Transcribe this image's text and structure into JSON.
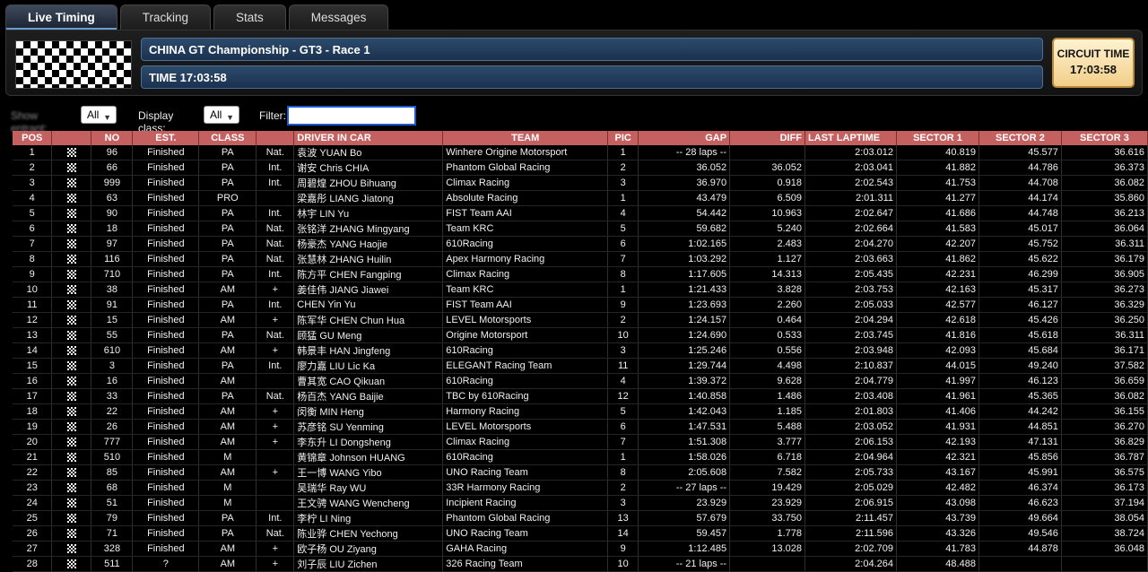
{
  "tabs": [
    "Live Timing",
    "Tracking",
    "Stats",
    "Messages"
  ],
  "header": {
    "title": "CHINA GT Championship - GT3 - Race 1",
    "time": "TIME 17:03:58",
    "circuit_label": "CIRCUIT TIME",
    "circuit_time": "17:03:58"
  },
  "filters": {
    "show_label": "Show entrant:",
    "show_value": "All",
    "class_label": "Display class:",
    "class_value": "All",
    "filter_label": "Filter:"
  },
  "columns": [
    "POS",
    "",
    "NO",
    "EST.",
    "CLASS",
    "",
    "DRIVER IN CAR",
    "TEAM",
    "PIC",
    "GAP",
    "DIFF",
    "LAST LAPTIME",
    "SECTOR 1",
    "SECTOR 2",
    "SECTOR 3"
  ],
  "rows": [
    [
      "1",
      "96",
      "Finished",
      "PA",
      "Nat.",
      "袁波 YUAN Bo",
      "Winhere Origine Motorsport",
      "1",
      "-- 28 laps --",
      "",
      "2:03.012",
      "40.819",
      "45.577",
      "36.616"
    ],
    [
      "2",
      "66",
      "Finished",
      "PA",
      "Int.",
      "谢安 Chris CHIA",
      "Phantom Global Racing",
      "2",
      "36.052",
      "36.052",
      "2:03.041",
      "41.882",
      "44.786",
      "36.373"
    ],
    [
      "3",
      "999",
      "Finished",
      "PA",
      "Int.",
      "周碧煌 ZHOU Bihuang",
      "Climax Racing",
      "3",
      "36.970",
      "0.918",
      "2:02.543",
      "41.753",
      "44.708",
      "36.082"
    ],
    [
      "4",
      "63",
      "Finished",
      "PRO",
      "",
      "梁嘉彤 LIANG Jiatong",
      "Absolute Racing",
      "1",
      "43.479",
      "6.509",
      "2:01.311",
      "41.277",
      "44.174",
      "35.860"
    ],
    [
      "5",
      "90",
      "Finished",
      "PA",
      "Int.",
      "林宇 LIN Yu",
      "FIST Team AAI",
      "4",
      "54.442",
      "10.963",
      "2:02.647",
      "41.686",
      "44.748",
      "36.213"
    ],
    [
      "6",
      "18",
      "Finished",
      "PA",
      "Nat.",
      "张铭洋 ZHANG Mingyang",
      "Team KRC",
      "5",
      "59.682",
      "5.240",
      "2:02.664",
      "41.583",
      "45.017",
      "36.064"
    ],
    [
      "7",
      "97",
      "Finished",
      "PA",
      "Nat.",
      "杨豪杰 YANG Haojie",
      "610Racing",
      "6",
      "1:02.165",
      "2.483",
      "2:04.270",
      "42.207",
      "45.752",
      "36.311"
    ],
    [
      "8",
      "116",
      "Finished",
      "PA",
      "Nat.",
      "张慧林 ZHANG Huilin",
      "Apex Harmony Racing",
      "7",
      "1:03.292",
      "1.127",
      "2:03.663",
      "41.862",
      "45.622",
      "36.179"
    ],
    [
      "9",
      "710",
      "Finished",
      "PA",
      "Int.",
      "陈方平 CHEN Fangping",
      "Climax Racing",
      "8",
      "1:17.605",
      "14.313",
      "2:05.435",
      "42.231",
      "46.299",
      "36.905"
    ],
    [
      "10",
      "38",
      "Finished",
      "AM",
      "+",
      "姜佳伟 JIANG Jiawei",
      "Team KRC",
      "1",
      "1:21.433",
      "3.828",
      "2:03.753",
      "42.163",
      "45.317",
      "36.273"
    ],
    [
      "11",
      "91",
      "Finished",
      "PA",
      "Int.",
      "CHEN Yin Yu",
      "FIST Team AAI",
      "9",
      "1:23.693",
      "2.260",
      "2:05.033",
      "42.577",
      "46.127",
      "36.329"
    ],
    [
      "12",
      "15",
      "Finished",
      "AM",
      "+",
      "陈军华 CHEN Chun Hua",
      "LEVEL Motorsports",
      "2",
      "1:24.157",
      "0.464",
      "2:04.294",
      "42.618",
      "45.426",
      "36.250"
    ],
    [
      "13",
      "55",
      "Finished",
      "PA",
      "Nat.",
      "顾猛 GU Meng",
      "Origine Motorsport",
      "10",
      "1:24.690",
      "0.533",
      "2:03.745",
      "41.816",
      "45.618",
      "36.311"
    ],
    [
      "14",
      "610",
      "Finished",
      "AM",
      "+",
      "韩景丰 HAN Jingfeng",
      "610Racing",
      "3",
      "1:25.246",
      "0.556",
      "2:03.948",
      "42.093",
      "45.684",
      "36.171"
    ],
    [
      "15",
      "3",
      "Finished",
      "PA",
      "Int.",
      "廖力嘉 LIU Lic Ka",
      "ELEGANT Racing Team",
      "11",
      "1:29.744",
      "4.498",
      "2:10.837",
      "44.015",
      "49.240",
      "37.582"
    ],
    [
      "16",
      "16",
      "Finished",
      "AM",
      "",
      "曹其宽 CAO Qikuan",
      "610Racing",
      "4",
      "1:39.372",
      "9.628",
      "2:04.779",
      "41.997",
      "46.123",
      "36.659"
    ],
    [
      "17",
      "33",
      "Finished",
      "PA",
      "Nat.",
      "杨百杰 YANG Baijie",
      "TBC by 610Racing",
      "12",
      "1:40.858",
      "1.486",
      "2:03.408",
      "41.961",
      "45.365",
      "36.082"
    ],
    [
      "18",
      "22",
      "Finished",
      "AM",
      "+",
      "闵衡 MIN Heng",
      "Harmony Racing",
      "5",
      "1:42.043",
      "1.185",
      "2:01.803",
      "41.406",
      "44.242",
      "36.155"
    ],
    [
      "19",
      "26",
      "Finished",
      "AM",
      "+",
      "苏彦铭 SU Yenming",
      "LEVEL Motorsports",
      "6",
      "1:47.531",
      "5.488",
      "2:03.052",
      "41.931",
      "44.851",
      "36.270"
    ],
    [
      "20",
      "777",
      "Finished",
      "AM",
      "+",
      "李东升 LI Dongsheng",
      "Climax Racing",
      "7",
      "1:51.308",
      "3.777",
      "2:06.153",
      "42.193",
      "47.131",
      "36.829"
    ],
    [
      "21",
      "510",
      "Finished",
      "M",
      "",
      "黄锦章 Johnson HUANG",
      "610Racing",
      "1",
      "1:58.026",
      "6.718",
      "2:04.964",
      "42.321",
      "45.856",
      "36.787"
    ],
    [
      "22",
      "85",
      "Finished",
      "AM",
      "+",
      "王一博 WANG Yibo",
      "UNO Racing Team",
      "8",
      "2:05.608",
      "7.582",
      "2:05.733",
      "43.167",
      "45.991",
      "36.575"
    ],
    [
      "23",
      "68",
      "Finished",
      "M",
      "",
      "吴瑞华 Ray WU",
      "33R Harmony Racing",
      "2",
      "-- 27 laps --",
      "19.429",
      "2:05.029",
      "42.482",
      "46.374",
      "36.173"
    ],
    [
      "24",
      "51",
      "Finished",
      "M",
      "",
      "王文骋 WANG Wencheng",
      "Incipient Racing",
      "3",
      "23.929",
      "23.929",
      "2:06.915",
      "43.098",
      "46.623",
      "37.194"
    ],
    [
      "25",
      "79",
      "Finished",
      "PA",
      "Int.",
      "李柠 LI Ning",
      "Phantom Global Racing",
      "13",
      "57.679",
      "33.750",
      "2:11.457",
      "43.739",
      "49.664",
      "38.054"
    ],
    [
      "26",
      "71",
      "Finished",
      "PA",
      "Nat.",
      "陈业骅 CHEN Yechong",
      "UNO Racing Team",
      "14",
      "59.457",
      "1.778",
      "2:11.596",
      "43.326",
      "49.546",
      "38.724"
    ],
    [
      "27",
      "328",
      "Finished",
      "AM",
      "+",
      "欧子杨 OU Ziyang",
      "GAHA Racing",
      "9",
      "1:12.485",
      "13.028",
      "2:02.709",
      "41.783",
      "44.878",
      "36.048"
    ],
    [
      "28",
      "511",
      "?",
      "AM",
      "+",
      "刘子辰 LIU Zichen",
      "326 Racing Team",
      "10",
      "-- 21 laps --",
      "",
      "2:04.264",
      "48.488",
      "",
      ""
    ]
  ],
  "highlights": [
    [
      3,
      13
    ],
    [
      17,
      12
    ],
    [
      17,
      13
    ],
    [
      18,
      11
    ]
  ],
  "colors": {
    "header_row": "#c56060",
    "best_green": "#38d43a",
    "title_bar": "#2d4a6a",
    "circuit_box": "#f1cf8a"
  }
}
